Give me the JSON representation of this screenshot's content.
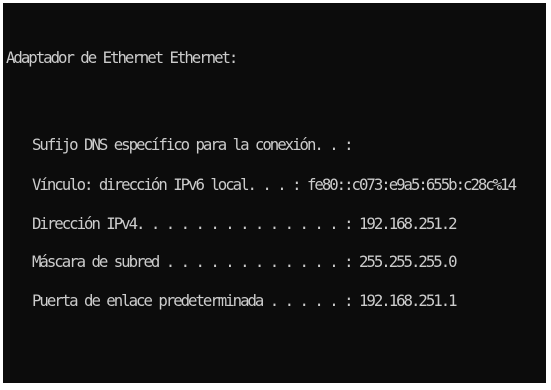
{
  "console": {
    "header": "Adaptador de Ethernet Ethernet:",
    "lines": [
      "Sufijo DNS específico para la conexión. . :",
      "Vínculo: dirección IPv6 local. . . : fe80::c073:e9a5:655b:c28c%14",
      "Dirección IPv4. . . . . . . . . . . . . . : 192.168.251.2",
      "Máscara de subred . . . . . . . . . . . . : 255.255.255.0",
      "Puerta de enlace predeterminada . . . . . : 192.168.251.1"
    ]
  },
  "colors": {
    "background": "#0c0c0c",
    "text": "#cccccc"
  }
}
